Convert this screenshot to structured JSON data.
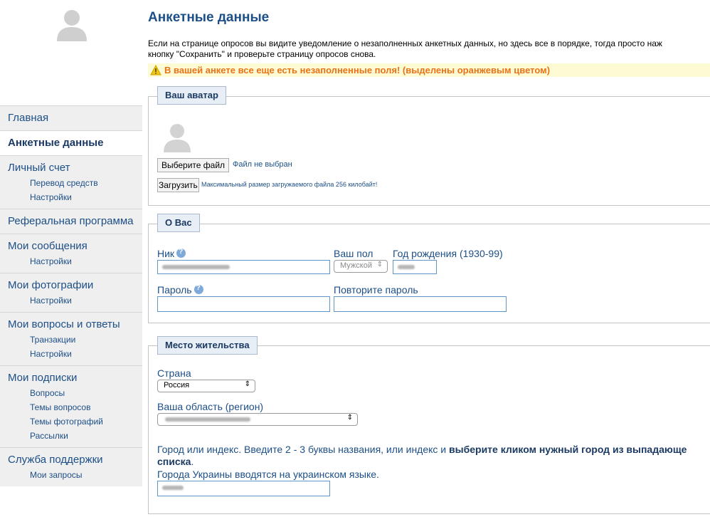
{
  "sidebar": {
    "nav": [
      {
        "label": "Главная",
        "active": false,
        "subs": []
      },
      {
        "label": "Анкетные данные",
        "active": true,
        "subs": []
      },
      {
        "label": "Личный счет",
        "active": false,
        "subs": [
          "Перевод средств",
          "Настройки"
        ]
      },
      {
        "label": "Реферальная программа",
        "active": false,
        "subs": []
      },
      {
        "label": "Мои сообщения",
        "active": false,
        "subs": [
          "Настройки"
        ]
      },
      {
        "label": "Мои фотографии",
        "active": false,
        "subs": [
          "Настройки"
        ]
      },
      {
        "label": "Мои вопросы и ответы",
        "active": false,
        "subs": [
          "Транзакции",
          "Настройки"
        ]
      },
      {
        "label": "Мои подписки",
        "active": false,
        "subs": [
          "Вопросы",
          "Темы вопросов",
          "Темы фотографий",
          "Рассылки"
        ]
      },
      {
        "label": "Служба поддержки",
        "active": false,
        "subs": [
          "Мои запросы"
        ]
      }
    ]
  },
  "page": {
    "title": "Анкетные данные",
    "intro_line1": "Если на странице опросов вы видите уведомление о незаполненных анкетных данных, но здесь все в порядке, тогда просто наж",
    "intro_line2": "кнопку \"Сохранить\" и проверьте страницу опросов снова.",
    "warning": "В вашей анкете все еще есть незаполненные поля! (выделены оранжевым цветом)"
  },
  "avatar_section": {
    "legend": "Ваш аватар",
    "choose_file_button": "Выберите файл",
    "no_file_text": "Файл не выбран",
    "upload_button": "Загрузить",
    "max_size_note": "Максимальный размер загружаемого файла 256 килобайт!"
  },
  "about_section": {
    "legend": "О Вас",
    "nick_label": "Ник",
    "gender_label": "Ваш пол",
    "gender_value": "Мужской",
    "birth_year_label": "Год рождения (1930-99)",
    "password_label": "Пароль",
    "repeat_password_label": "Повторите пароль"
  },
  "residence_section": {
    "legend": "Место жительства",
    "country_label": "Страна",
    "country_value": "Россия",
    "region_label": "Ваша область (регион)",
    "city_hint_plain": "Город или индекс. Введите 2 - 3 буквы названия, или индекс и ",
    "city_hint_bold": "выберите кликом нужный город из выпадающе",
    "city_hint_bold2": "списка",
    "city_hint_dot": ".",
    "ukraine_note": "Города Украины вводятся на украинском языке."
  },
  "colors": {
    "link": "#1d4f87",
    "warning_text": "#e8731b",
    "warning_bg": "#fdfbd3",
    "input_border": "#5f95c7"
  }
}
